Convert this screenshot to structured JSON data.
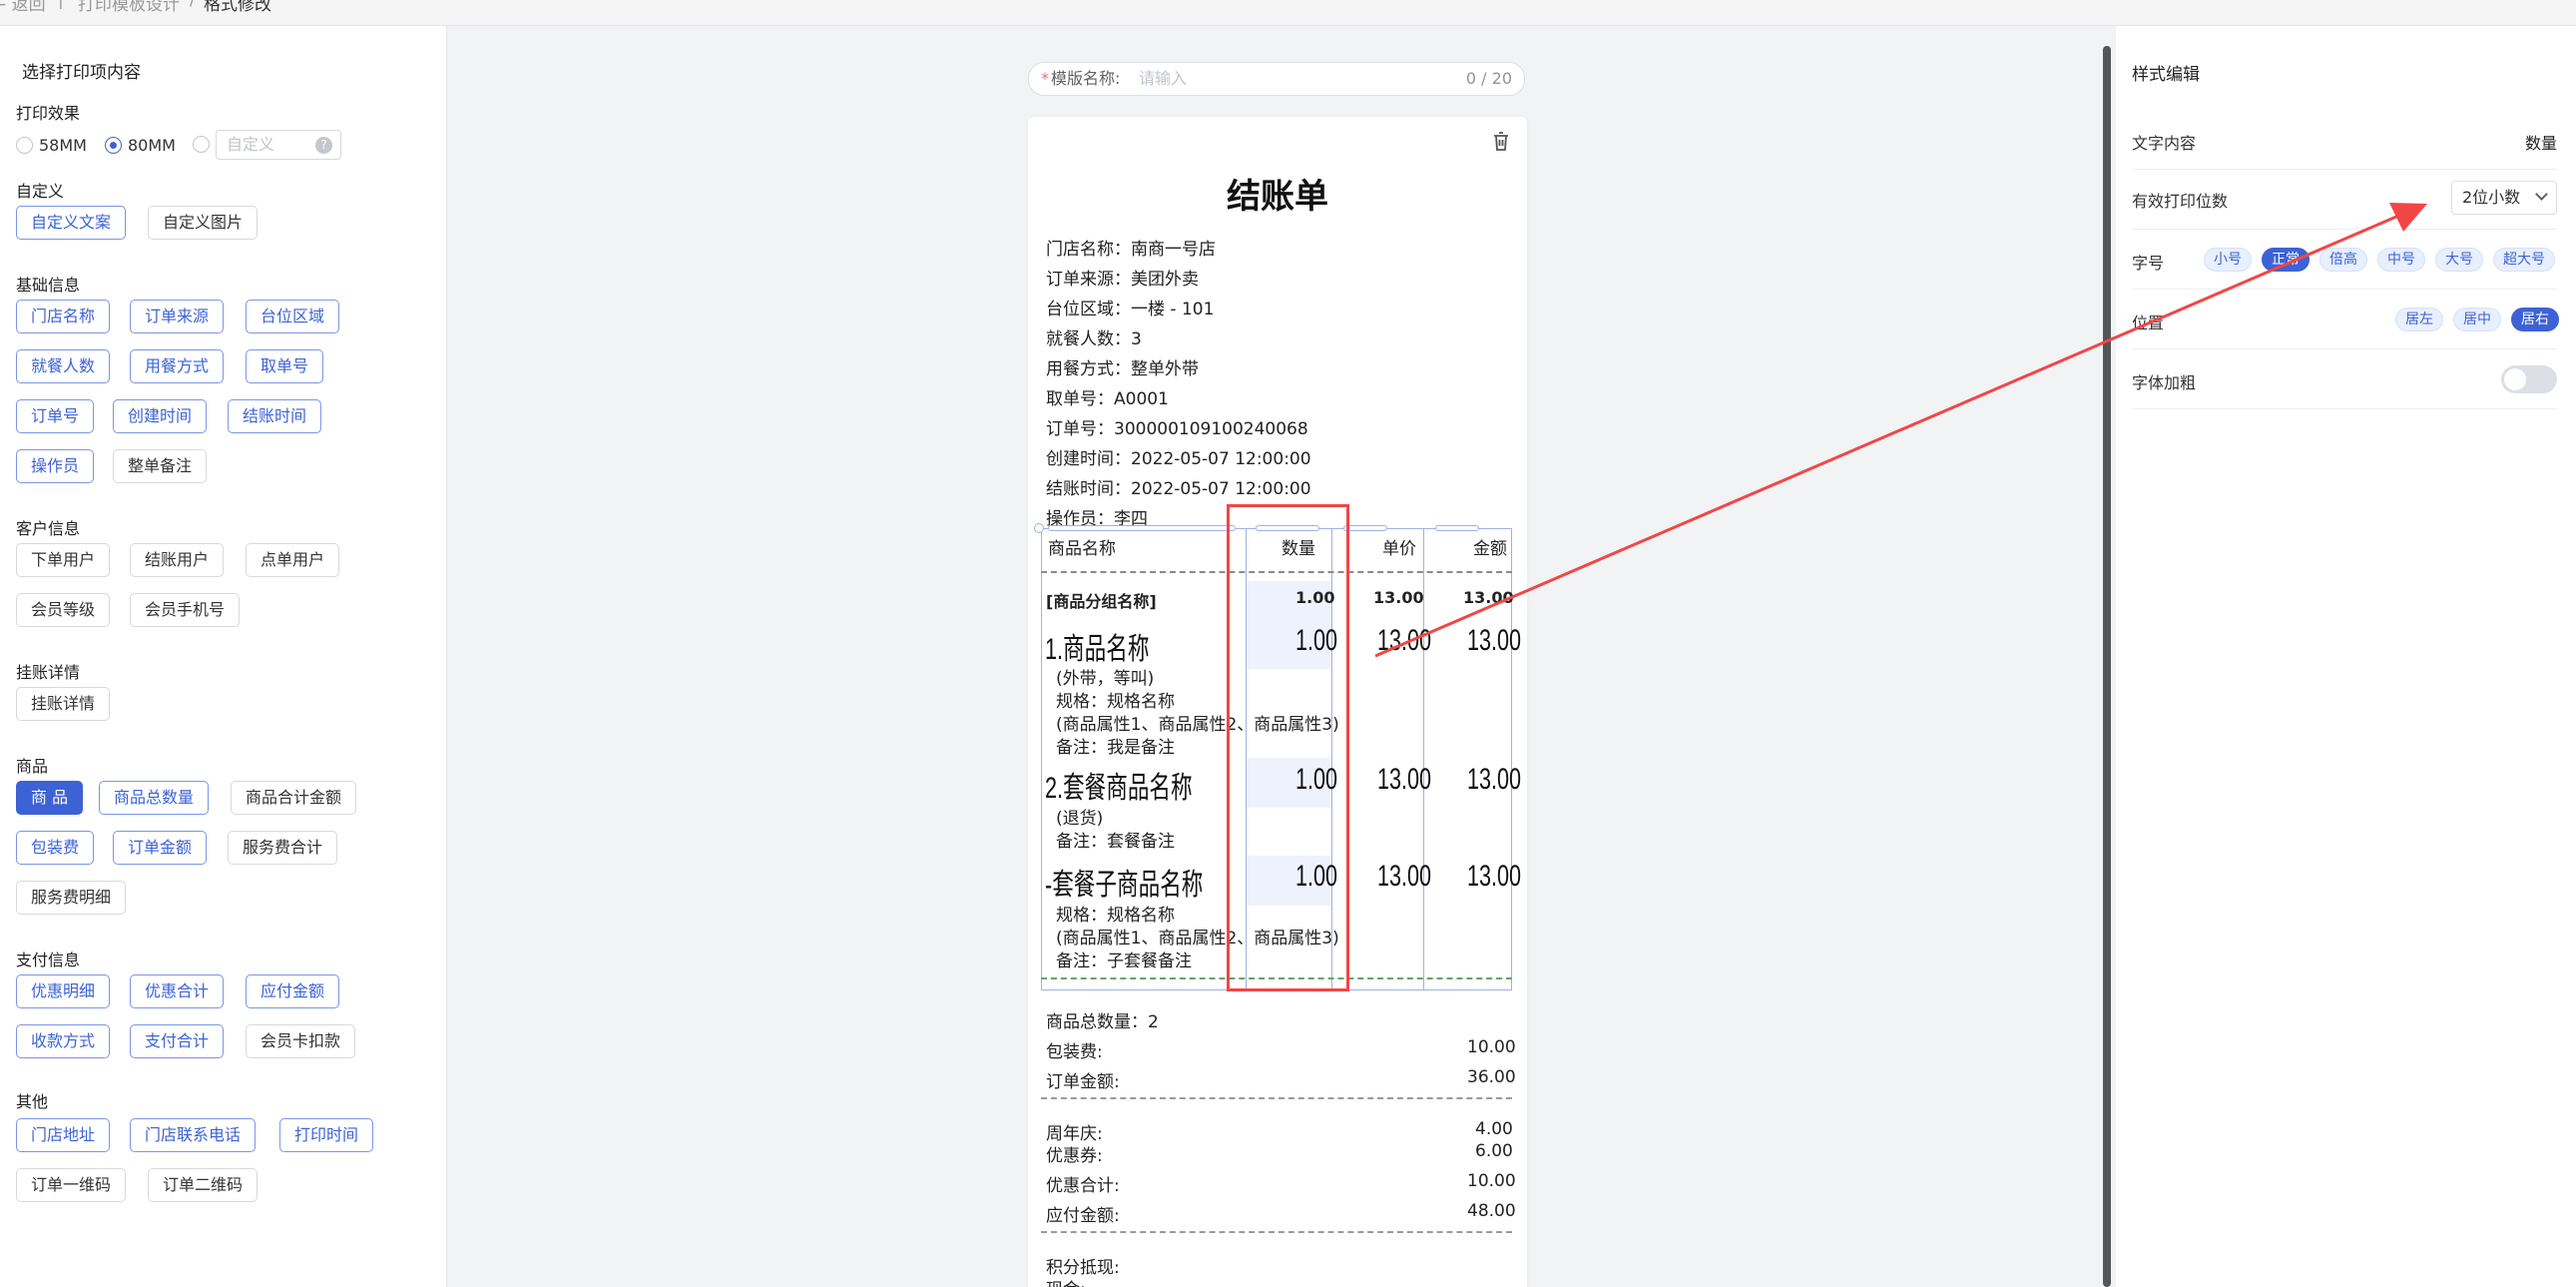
{
  "breadcrumb": {
    "back": "← 返回",
    "parent": "打印模板设计",
    "sep": "/",
    "current": "格式修改"
  },
  "left": {
    "title": "选择打印项内容",
    "print_effect": {
      "label": "打印效果",
      "options": [
        "58MM",
        "80MM"
      ],
      "selected": "80MM",
      "custom_placeholder": "自定义",
      "help": "?"
    },
    "sections": {
      "custom": {
        "label": "自定义",
        "items": [
          "自定义文案",
          "自定义图片"
        ]
      },
      "basic": {
        "label": "基础信息",
        "items": [
          "门店名称",
          "订单来源",
          "台位区域",
          "就餐人数",
          "用餐方式",
          "取单号",
          "订单号",
          "创建时间",
          "结账时间",
          "操作员",
          "整单备注"
        ]
      },
      "customer": {
        "label": "客户信息",
        "items": [
          "下单用户",
          "结账用户",
          "点单用户",
          "会员等级",
          "会员手机号"
        ]
      },
      "credit": {
        "label": "挂账详情",
        "items": [
          "挂账详情"
        ]
      },
      "goods": {
        "label": "商品",
        "items": [
          "商 品",
          "商品总数量",
          "商品合计金额",
          "包装费",
          "订单金额",
          "服务费合计",
          "服务费明细"
        ]
      },
      "pay": {
        "label": "支付信息",
        "items": [
          "优惠明细",
          "优惠合计",
          "应付金额",
          "收款方式",
          "支付合计",
          "会员卡扣款"
        ]
      },
      "other": {
        "label": "其他",
        "items": [
          "门店地址",
          "门店联系电话",
          "打印时间",
          "订单一维码",
          "订单二维码"
        ]
      }
    }
  },
  "template_name": {
    "required_mark": "*",
    "label": "模版名称:",
    "placeholder": "请输入",
    "counter": "0 / 20"
  },
  "receipt": {
    "title": "结账单",
    "info": [
      "门店名称：南商一号店",
      "订单来源：美团外卖",
      "台位区域：一楼 - 101",
      "就餐人数：3",
      "用餐方式：整单外带",
      "取单号：A0001",
      "订单号：300000109100240068",
      "创建时间：2022-05-07 12:00:00",
      "结账时间：2022-05-07 12:00:00",
      "操作员：李四"
    ],
    "table": {
      "headers": [
        "商品名称",
        "数量",
        "单价",
        "金额"
      ],
      "group": {
        "name": "[商品分组名称]",
        "qty": "1.00",
        "price": "13.00",
        "amount": "13.00"
      },
      "item1": {
        "name": "1.商品名称",
        "qty": "1.00",
        "price": "13.00",
        "amount": "13.00",
        "notes": [
          "(外带，等叫)",
          "规格：规格名称",
          "(商品属性1、商品属性2、商品属性3)",
          "备注：我是备注"
        ]
      },
      "item2": {
        "name": "2.套餐商品名称",
        "qty": "1.00",
        "price": "13.00",
        "amount": "13.00",
        "notes": [
          "(退货)",
          "备注：套餐备注"
        ]
      },
      "item3": {
        "name": "-套餐子商品名称",
        "qty": "1.00",
        "price": "13.00",
        "amount": "13.00",
        "notes": [
          "规格：规格名称",
          "(商品属性1、商品属性2、商品属性3)",
          "备注：子套餐备注"
        ]
      }
    },
    "summary": {
      "total_qty": "商品总数量：2",
      "packing_label": "包装费:",
      "packing": "10.00",
      "order_label": "订单金额:",
      "order": "36.00",
      "anniv_label": "周年庆:",
      "anniv": "4.00",
      "coupon_label": "优惠券:",
      "coupon": "6.00",
      "disc_label": "优惠合计:",
      "disc": "10.00",
      "payable_label": "应付金额:",
      "payable": "48.00",
      "points_label": "积分抵现:",
      "cash_label": "现金:"
    }
  },
  "right": {
    "title": "样式编辑",
    "text_content_label": "文字内容",
    "text_content_value": "数量",
    "precision_label": "有效打印位数",
    "precision_value": "2位小数",
    "font_size_label": "字号",
    "font_sizes": [
      "小号",
      "正常",
      "倍高",
      "中号",
      "大号",
      "超大号"
    ],
    "font_size_selected": "正常",
    "position_label": "位置",
    "positions": [
      "居左",
      "居中",
      "居右"
    ],
    "position_selected": "居右",
    "bold_label": "字体加粗",
    "bold_on": false
  },
  "colors": {
    "accent": "#3d62d6",
    "highlight_red": "#f24646"
  }
}
